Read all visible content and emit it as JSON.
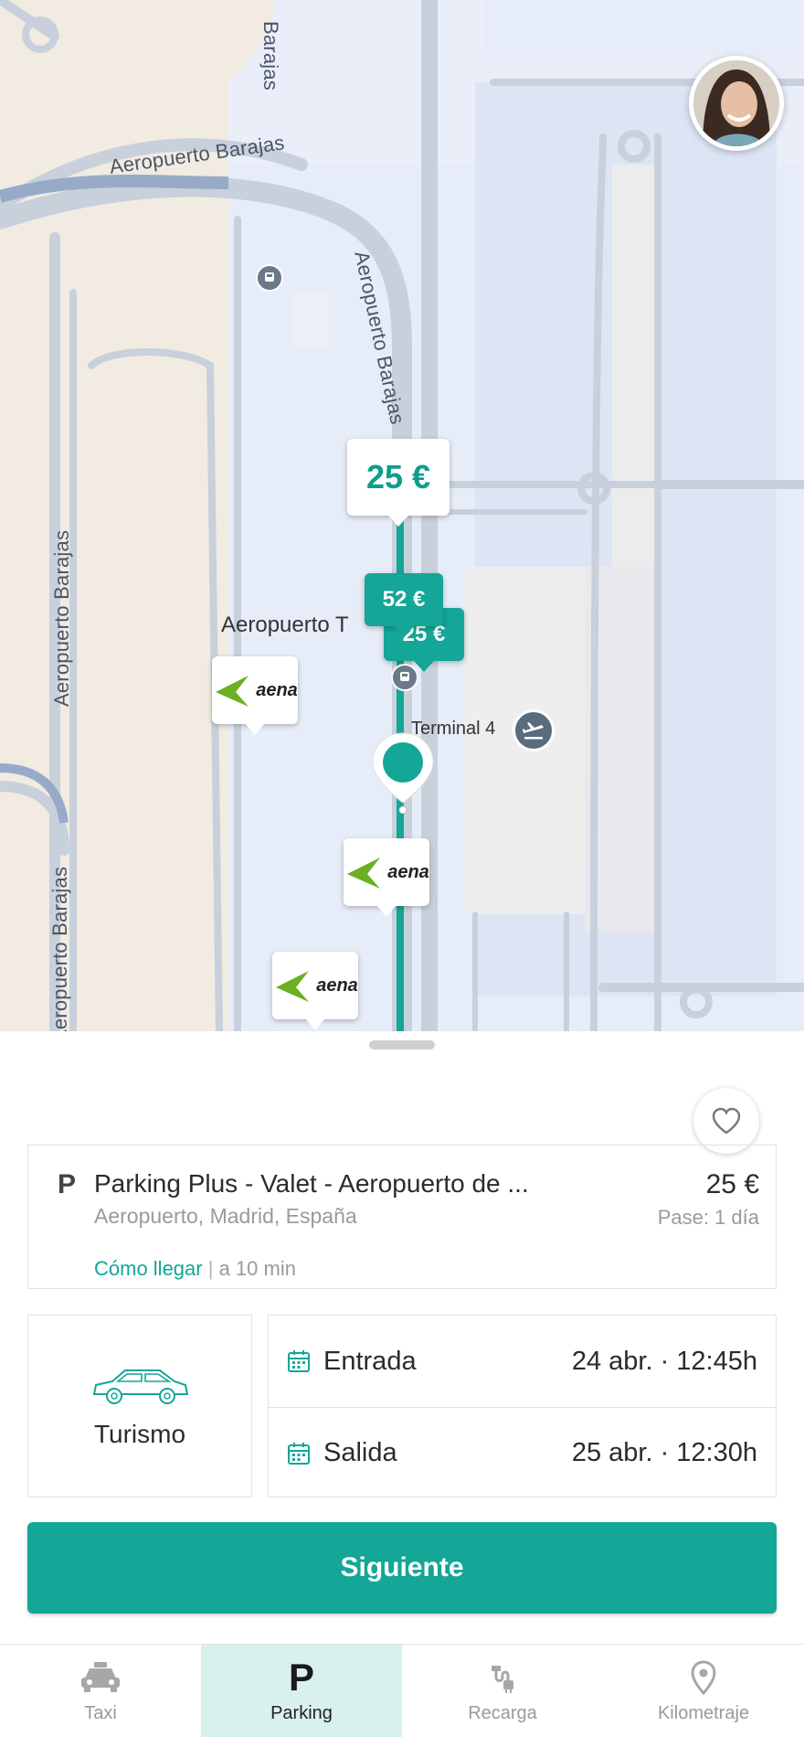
{
  "map": {
    "road_labels": {
      "barajas_top": "Barajas",
      "aeropuerto_barajas_curve": "Aeropuerto Barajas",
      "aeropuerto_barajas_diag": "Aeropuerto Barajas",
      "aeropuerto_barajas_left": "Aeropuerto Barajas",
      "aeropuerto_barajas_bottom": "Aeropuerto Barajas"
    },
    "poi_terminal_main": "Aeropuerto T",
    "poi_terminal4": "Terminal 4",
    "price_pins": [
      "25 €",
      "52 €",
      "25 €"
    ],
    "aena_logo_text": "aena",
    "colors": {
      "accent": "#14a697",
      "aena_green": "#6ab023"
    }
  },
  "sheet": {
    "place": {
      "letter": "P",
      "name": "Parking Plus - Valet - Aeropuerto de ...",
      "address": "Aeropuerto, Madrid, España",
      "price": "25 €",
      "pass": "Pase: 1 día",
      "how_to_get": "Cómo llegar",
      "separator": "|",
      "distance": "a 10 min"
    },
    "vehicle": {
      "label": "Turismo"
    },
    "dates": [
      {
        "label": "Entrada",
        "value": "24 abr. · 12:45h"
      },
      {
        "label": "Salida",
        "value": "25 abr. · 12:30h"
      }
    ],
    "next_button": "Siguiente"
  },
  "nav": [
    {
      "label": "Taxi",
      "icon": "taxi-icon"
    },
    {
      "label": "Parking",
      "icon": "parking-icon"
    },
    {
      "label": "Recarga",
      "icon": "charging-icon"
    },
    {
      "label": "Kilometraje",
      "icon": "location-pin-icon"
    }
  ]
}
